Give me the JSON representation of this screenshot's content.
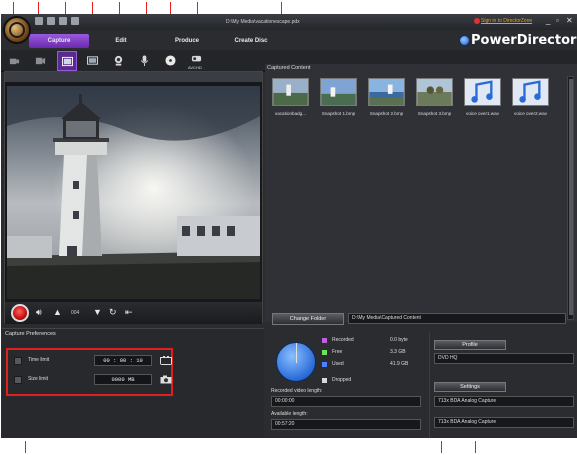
{
  "window": {
    "title": "D:\\My Media\\vacationescape.pdx",
    "sign_in_text": "Sign in to DirectorZone",
    "brand": "PowerDirector",
    "min_glyph": "_",
    "restore_glyph": "▫",
    "close_glyph": "✕"
  },
  "tabs": [
    {
      "label": "Capture",
      "active": true
    },
    {
      "label": "Edit",
      "active": false
    },
    {
      "label": "Produce",
      "active": false
    },
    {
      "label": "Create Disc",
      "active": false
    }
  ],
  "toolbar": {
    "tools": [
      {
        "name": "capture-dv-icon"
      },
      {
        "name": "capture-hdv-icon"
      },
      {
        "name": "capture-tv-icon"
      },
      {
        "name": "capture-dtv-icon"
      },
      {
        "name": "capture-webcam-icon"
      },
      {
        "name": "capture-microphone-icon"
      },
      {
        "name": "capture-cd-icon"
      },
      {
        "name": "capture-avchd-icon"
      }
    ],
    "avchd_label": "AVCHD"
  },
  "preview": {
    "frame": "004"
  },
  "capture_preferences": {
    "title": "Capture Preferences",
    "time_limit_label": "Time limit",
    "time_limit_value": "00 : 00 : 10",
    "size_limit_label": "Size limit",
    "size_limit_value": "0000   MB"
  },
  "captured_content": {
    "title": "Captured Content",
    "items": [
      {
        "caption": "vacationbadg...",
        "kind": "video"
      },
      {
        "caption": "Snapshot 1.bmp",
        "kind": "image"
      },
      {
        "caption": "Snapshot 2.bmp",
        "kind": "image"
      },
      {
        "caption": "Snapshot 3.bmp",
        "kind": "image"
      },
      {
        "caption": "voice over1.wav",
        "kind": "audio"
      },
      {
        "caption": "voice over2.wav",
        "kind": "audio"
      }
    ]
  },
  "folder": {
    "button_label": "Change Folder",
    "path": "D:\\My Media\\Captured Content"
  },
  "disk_stats": {
    "rows": [
      {
        "label": "Recorded",
        "value": "0.0  byte",
        "color": "#c060e0"
      },
      {
        "label": "Free",
        "value": "3.3  GB",
        "color": "#70e060"
      },
      {
        "label": "Used",
        "value": "41.9 GB",
        "color": "#5080ff"
      },
      {
        "label": "Dropped",
        "value": "",
        "color": "#d8d8d8"
      }
    ],
    "recorded_length_label": "Recorded video length:",
    "recorded_length_value": "00:00:00",
    "available_length_label": "Available length:",
    "available_length_value": "00:57:20"
  },
  "profile": {
    "profile_button": "Profile",
    "profile_value": "DVD HQ",
    "settings_button": "Settings",
    "device_value_1": "713x BDA Analog Capture",
    "device_value_2": "713x BDA Analog Capture"
  },
  "colors": {
    "accent": "#7a3ac8",
    "callout": "#e02020"
  }
}
